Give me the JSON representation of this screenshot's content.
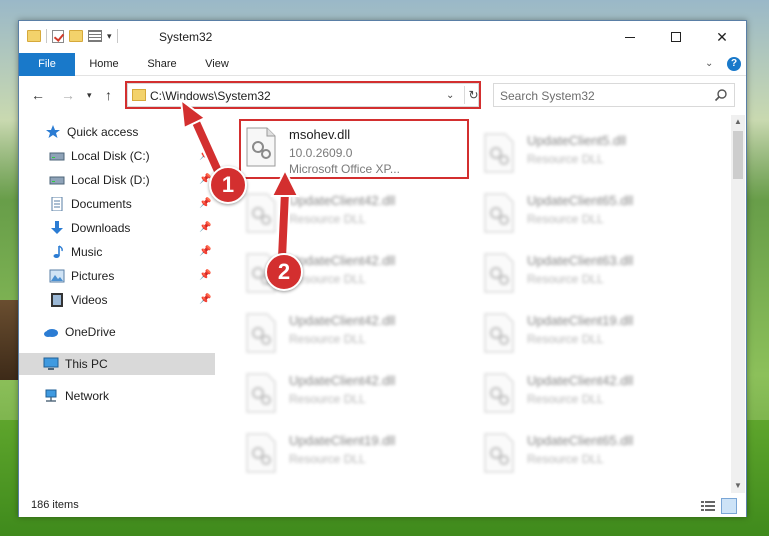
{
  "window": {
    "title": "System32",
    "controls": {
      "minimize": "—",
      "maximize": "☐",
      "close": "✕"
    }
  },
  "ribbon": {
    "tabs": [
      {
        "label": "File"
      },
      {
        "label": "Home"
      },
      {
        "label": "Share"
      },
      {
        "label": "View"
      }
    ],
    "help": "?"
  },
  "address": {
    "path": "C:\\Windows\\System32",
    "search_placeholder": "Search System32"
  },
  "sidebar": {
    "items": [
      {
        "label": "Quick access",
        "icon": "star-icon",
        "pinned": false
      },
      {
        "label": "Local Disk (C:)",
        "icon": "drive-icon",
        "pinned": true
      },
      {
        "label": "Local Disk (D:)",
        "icon": "drive-icon",
        "pinned": true
      },
      {
        "label": "Documents",
        "icon": "documents-icon",
        "pinned": true
      },
      {
        "label": "Downloads",
        "icon": "download-icon",
        "pinned": true
      },
      {
        "label": "Music",
        "icon": "music-icon",
        "pinned": true
      },
      {
        "label": "Pictures",
        "icon": "pictures-icon",
        "pinned": true
      },
      {
        "label": "Videos",
        "icon": "videos-icon",
        "pinned": true
      },
      {
        "label": "OneDrive",
        "icon": "cloud-icon",
        "pinned": false
      },
      {
        "label": "This PC",
        "icon": "computer-icon",
        "pinned": false,
        "selected": true
      },
      {
        "label": "Network",
        "icon": "network-icon",
        "pinned": false
      }
    ]
  },
  "files": {
    "highlighted": {
      "name": "msohev.dll",
      "version": "10.0.2609.0",
      "description": "Microsoft Office XP..."
    },
    "left_column": [
      {
        "name": "UpdateClient42.dll",
        "description": "Resource DLL"
      },
      {
        "name": "UpdateClient42.dll",
        "description": "Resource DLL"
      },
      {
        "name": "UpdateClient42.dll",
        "description": "Resource DLL"
      },
      {
        "name": "UpdateClient42.dll",
        "description": "Resource DLL"
      },
      {
        "name": "UpdateClient19.dll",
        "description": "Resource DLL"
      }
    ],
    "right_column": [
      {
        "name": "UpdateClient5.dll",
        "description": "Resource DLL"
      },
      {
        "name": "UpdateClient65.dll",
        "description": "Resource DLL"
      },
      {
        "name": "UpdateClient63.dll",
        "description": "Resource DLL"
      },
      {
        "name": "UpdateClient19.dll",
        "description": "Resource DLL"
      },
      {
        "name": "UpdateClient42.dll",
        "description": "Resource DLL"
      },
      {
        "name": "UpdateClient65.dll",
        "description": "Resource DLL"
      }
    ]
  },
  "status": {
    "count": "186 items"
  },
  "annotations": {
    "step1": "1",
    "step2": "2",
    "color": "#d32f2f"
  }
}
